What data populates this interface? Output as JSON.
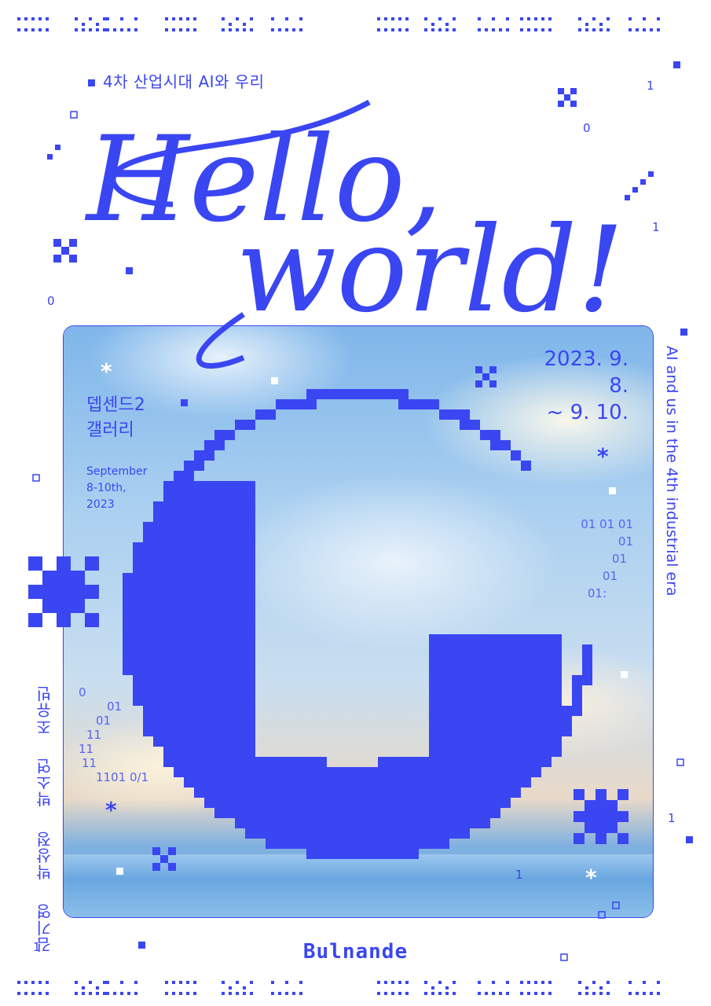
{
  "header": {
    "subtitle": "4차 산업시대 AI와 우리",
    "title_line1": "Hello,",
    "title_line2": "world!"
  },
  "event": {
    "date_line1": "2023. 9. 8.",
    "date_line2": "~ 9. 10.",
    "venue_line1": "뎁센드2",
    "venue_line2": "갤러리",
    "venue_en_line1": "September",
    "venue_en_line2": "8-10th,",
    "venue_en_line3": "2023",
    "side_caption": "AI and us in the 4th industrial era"
  },
  "artists": [
    "김기영",
    "박상정",
    "박소연",
    "조유빈"
  ],
  "binary": {
    "right_lines": [
      "01 01 01",
      "01",
      "01",
      "01",
      "01:"
    ],
    "left_lines": [
      "0",
      "01",
      "01",
      "11",
      "11",
      "11",
      "1101 0/1"
    ],
    "scattered": [
      "1",
      "0",
      "1",
      "0",
      "1",
      "1",
      "1"
    ]
  },
  "footer": {
    "brand": "Bulnande"
  },
  "colors": {
    "accent": "#3a46f2",
    "background": "#ffffff"
  },
  "icons": [
    "pixel-globe-icon",
    "pixel-asterisk-icon",
    "pixel-x-icon",
    "dot-pattern-border"
  ]
}
